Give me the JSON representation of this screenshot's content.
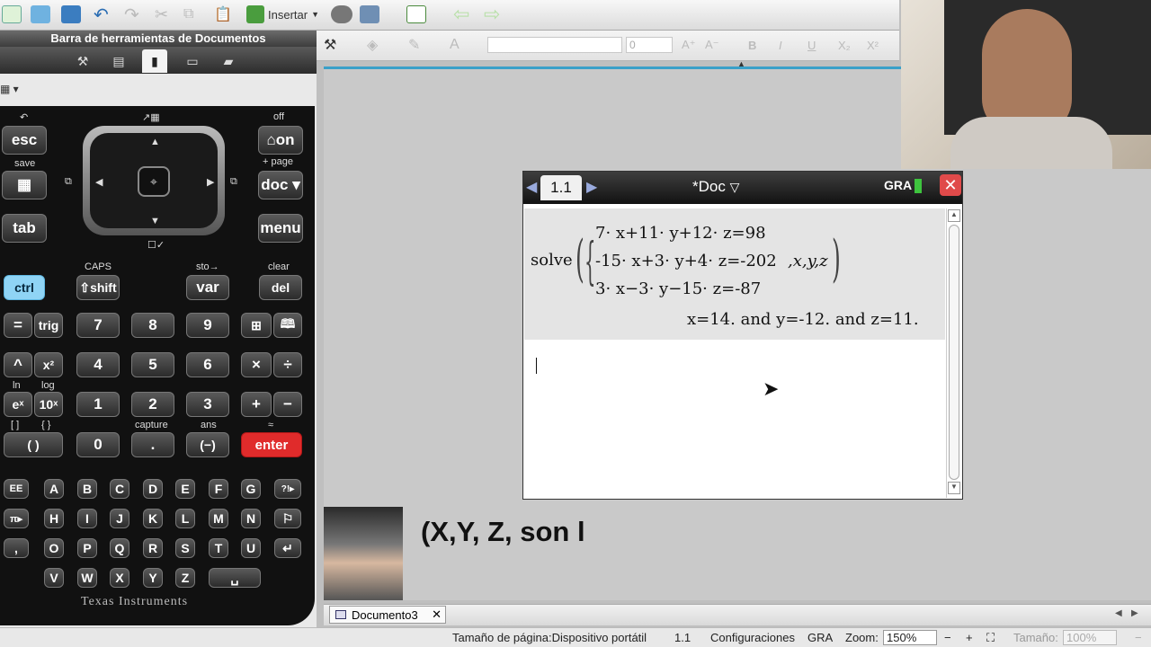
{
  "toolbar": {
    "insert_label": "Insertar"
  },
  "doc_toolbar": {
    "title": "Barra de herramientas de Documentos"
  },
  "format": {
    "font_size": "0"
  },
  "calculator": {
    "labels": {
      "off": "off",
      "save": "save",
      "page": "+ page",
      "caps": "CAPS",
      "sto": "sto→",
      "clear": "clear",
      "ln": "ln",
      "log": "log",
      "capture": "capture",
      "ans": "ans",
      "brace": "{ }",
      "bracket": "[ ]",
      "approx": "≈"
    },
    "keys": {
      "esc": "esc",
      "on": "⌂on",
      "save": "▦",
      "doc": "doc ▾",
      "tab": "tab",
      "menu": "menu",
      "ctrl": "ctrl",
      "shift": "⇧shift",
      "var": "var",
      "del": "del",
      "eq": "=",
      "trig": "trig",
      "k7": "7",
      "k8": "8",
      "k9": "9",
      "tmpl": "⊞",
      "cat": "🕮",
      "caret": "^",
      "x2": "x²",
      "k4": "4",
      "k5": "5",
      "k6": "6",
      "mul": "×",
      "div": "÷",
      "ex": "eˣ",
      "tenx": "10ˣ",
      "k1": "1",
      "k2": "2",
      "k3": "3",
      "plus": "+",
      "minus": "−",
      "paren": "(  )",
      "k0": "0",
      "dot": ".",
      "neg": "(−)",
      "enter": "enter",
      "EE": "EE",
      "A": "A",
      "B": "B",
      "C": "C",
      "D": "D",
      "E": "E",
      "F": "F",
      "G": "G",
      "punct": "?!▸",
      "pi": "π▸",
      "H": "H",
      "I": "I",
      "J": "J",
      "K": "K",
      "L": "L",
      "M": "M",
      "N": "N",
      "flag": "⚐",
      "comma": ",",
      "O": "O",
      "P": "P",
      "Q": "Q",
      "R": "R",
      "S": "S",
      "T": "T",
      "U": "U",
      "ret": "↵",
      "V": "V",
      "W": "W",
      "X": "X",
      "Y": "Y",
      "Z": "Z",
      "space": "␣"
    },
    "brand": "Texas Instruments"
  },
  "screen": {
    "tab": "1.1",
    "doc_title": "*Doc",
    "mode": "GRA",
    "cmd": "solve",
    "eq1": "7· x+11· y+12· z=98",
    "eq2": "-15· x+3· y+4· z=-202",
    "eq3": "3· x−3· y−15· z=-87",
    "vars": ",x,y,z",
    "result": "x=14. and y=-12. and z=11."
  },
  "caption": "(X,Y, Z, son l",
  "tabs": {
    "document": "Documento3"
  },
  "status": {
    "page_size": "Tamaño de página:Dispositivo portátil",
    "page": "1.1",
    "settings": "Configuraciones",
    "mode": "GRA",
    "zoom_label": "Zoom:",
    "zoom_value": "150%",
    "size_label": "Tamaño:",
    "size_value": "100%"
  },
  "colors": {
    "accent": "#3aa0c8",
    "enter": "#e02b2b",
    "ctrl": "#8fd4f5",
    "close": "#e04a4a"
  }
}
